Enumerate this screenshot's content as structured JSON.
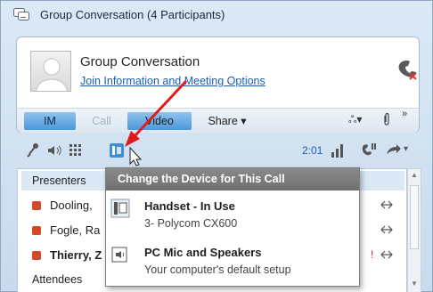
{
  "window": {
    "title": "Group Conversation (4 Participants)"
  },
  "header": {
    "name": "Group Conversation",
    "link": "Join Information and Meeting Options"
  },
  "modes": {
    "im": "IM",
    "call": "Call",
    "video": "Video",
    "share": "Share ▾"
  },
  "toolbar": {
    "timer": "2:01"
  },
  "roster": {
    "presenters_label": "Presenters",
    "rows": [
      "Dooling,",
      "Fogle, Ra",
      "Thierry, Z"
    ],
    "attendees_label": "Attendees"
  },
  "popup": {
    "title": "Change the Device for This Call",
    "options": [
      {
        "title": "Handset - In Use",
        "subtitle": "3- Polycom CX600"
      },
      {
        "title": "PC Mic and Speakers",
        "subtitle": "Your computer's default setup"
      }
    ]
  },
  "colors": {
    "link": "#1a5fb4",
    "accent": "#4c97da",
    "popup_header": "#7a7a7a",
    "arrow": "#e01b1b",
    "presence_busy": "#d34a26"
  }
}
